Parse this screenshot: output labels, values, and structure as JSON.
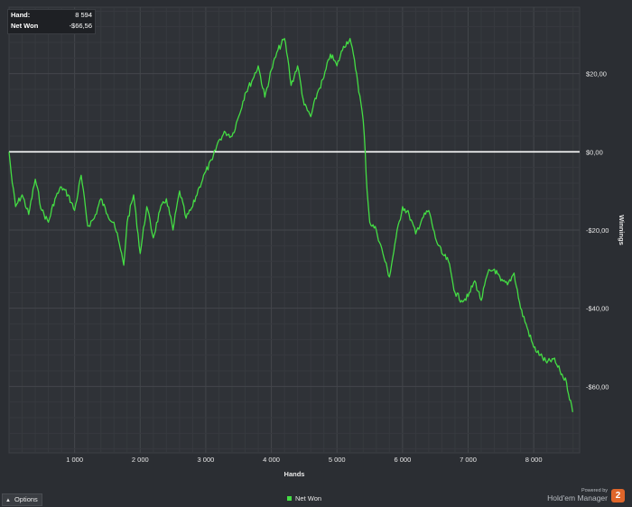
{
  "info": {
    "hand_label": "Hand:",
    "hand_value": "8 594",
    "netwon_label": "Net Won",
    "netwon_value": "-$66,56"
  },
  "options_label": "Options",
  "legend_label": "Net Won",
  "branding": {
    "powered_by": "Powered by",
    "product": "Hold'em Manager",
    "logo": "2"
  },
  "colors": {
    "background": "#2b2e33",
    "series": "#44dd44",
    "zero_line": "#ffffff",
    "grid": "#3d4045"
  },
  "chart_data": {
    "type": "line",
    "title": "",
    "xlabel": "Hands",
    "ylabel": "Winnings",
    "xlim": [
      0,
      8700
    ],
    "ylim": [
      -77,
      37
    ],
    "x_ticks": [
      1000,
      2000,
      3000,
      4000,
      5000,
      6000,
      7000,
      8000
    ],
    "x_tick_labels": [
      "1 000",
      "2 000",
      "3 000",
      "4 000",
      "5 000",
      "6 000",
      "7 000",
      "8 000"
    ],
    "y_ticks": [
      20,
      0,
      -20,
      -40,
      -60
    ],
    "y_tick_labels": [
      "$20,00",
      "$0,00",
      "-$20,00",
      "-$40,00",
      "-$60,00"
    ],
    "grid": true,
    "legend_position": "bottom-center",
    "series": [
      {
        "name": "Net Won",
        "x": [
          0,
          50,
          100,
          200,
          300,
          400,
          500,
          600,
          700,
          800,
          900,
          1000,
          1100,
          1200,
          1300,
          1400,
          1500,
          1600,
          1700,
          1750,
          1800,
          1900,
          2000,
          2100,
          2200,
          2300,
          2400,
          2500,
          2600,
          2700,
          2800,
          2900,
          3000,
          3100,
          3200,
          3300,
          3400,
          3500,
          3600,
          3700,
          3800,
          3900,
          4000,
          4100,
          4200,
          4250,
          4300,
          4400,
          4500,
          4600,
          4700,
          4800,
          4900,
          5000,
          5100,
          5200,
          5300,
          5400,
          5430,
          5460,
          5500,
          5600,
          5700,
          5800,
          5900,
          6000,
          6100,
          6200,
          6300,
          6400,
          6500,
          6600,
          6700,
          6800,
          6900,
          7000,
          7100,
          7200,
          7300,
          7400,
          7500,
          7600,
          7700,
          7800,
          7900,
          8000,
          8100,
          8200,
          8300,
          8400,
          8500,
          8594
        ],
        "values": [
          0,
          -8,
          -14,
          -11,
          -16,
          -7,
          -15,
          -18,
          -12,
          -9,
          -11,
          -15,
          -6,
          -19,
          -17,
          -12,
          -16,
          -18,
          -25,
          -29,
          -18,
          -11,
          -26,
          -14,
          -22,
          -15,
          -12,
          -20,
          -10,
          -17,
          -14,
          -9,
          -5,
          -2,
          3,
          5,
          4,
          9,
          15,
          18,
          22,
          14,
          21,
          26,
          29,
          24,
          17,
          22,
          12,
          9,
          15,
          19,
          25,
          22,
          27,
          29,
          20,
          8,
          0,
          -10,
          -18,
          -20,
          -26,
          -32,
          -22,
          -14,
          -16,
          -21,
          -17,
          -15,
          -22,
          -26,
          -28,
          -36,
          -38,
          -37,
          -33,
          -38,
          -31,
          -30,
          -33,
          -34,
          -31,
          -40,
          -45,
          -50,
          -52,
          -54,
          -53,
          -56,
          -59,
          -66.56
        ]
      }
    ]
  }
}
